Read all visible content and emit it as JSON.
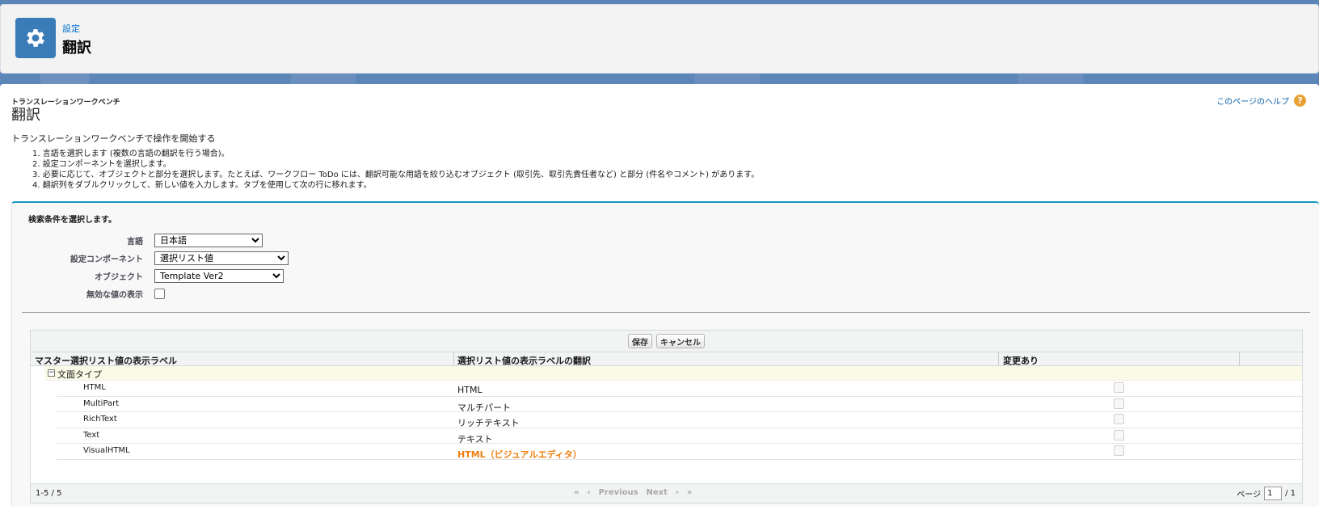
{
  "header": {
    "breadcrumb": "設定",
    "title": "翻訳",
    "icon": "gear-icon",
    "icon_color": "#3a7cb8"
  },
  "page": {
    "small_title": "トランスレーションワークベンチ",
    "big_title": "翻訳",
    "help_link": "このページのヘルプ",
    "help_icon": "?",
    "intro": "トランスレーションワークベンチで操作を開始する",
    "steps": [
      "1. 言語を選択します (複数の言語の翻訳を行う場合)。",
      "2. 設定コンポーネントを選択します。",
      "3. 必要に応じて、オブジェクトと部分を選択します。たとえば、ワークフロー ToDo には、翻訳可能な用語を絞り込むオブジェクト (取引先、取引先責任者など) と部分 (件名やコメント) があります。",
      "4. 翻訳列をダブルクリックして、新しい値を入力します。タブを使用して次の行に移れます。"
    ]
  },
  "filter": {
    "heading": "検索条件を選択します。",
    "language_label": "言語",
    "language_value": "日本語",
    "component_label": "設定コンポーネント",
    "component_value": "選択リスト値",
    "object_label": "オブジェクト",
    "object_value": "Template Ver2",
    "inactive_label": "無効な値の表示"
  },
  "grid": {
    "save_label": "保存",
    "cancel_label": "キャンセル",
    "columns": [
      "マスター選択リスト値の表示ラベル",
      "選択リスト値の表示ラベルの翻訳",
      "変更あり"
    ],
    "group_label": "文面タイプ",
    "rows": [
      {
        "master": "HTML",
        "translation": "HTML"
      },
      {
        "master": "MultiPart",
        "translation": "マルチパート"
      },
      {
        "master": "RichText",
        "translation": "リッチテキスト"
      },
      {
        "master": "Text",
        "translation": "テキスト"
      },
      {
        "master": "VisualHTML",
        "translation": "HTML（ビジュアルエディタ）"
      }
    ],
    "edited_color": "#f07f0f",
    "range": "1-5 / 5",
    "first": "«",
    "prev_arrow": "‹",
    "previous": "Previous",
    "next": "Next",
    "next_arrow": "›",
    "last": "»",
    "page_label": "ページ",
    "page_value": "1",
    "page_total": "/ 1"
  }
}
